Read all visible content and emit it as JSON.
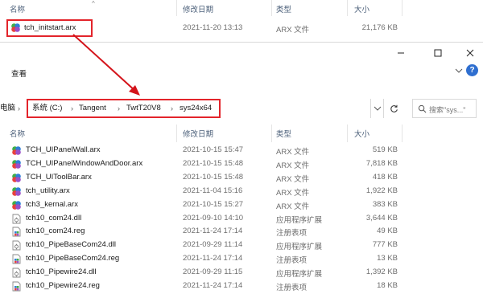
{
  "back_window": {
    "columns": {
      "name": "名称",
      "date": "修改日期",
      "type": "类型",
      "size": "大小"
    },
    "file": {
      "name": "tch_initstart.arx",
      "date": "2021-11-20 13:13",
      "type": "ARX 文件",
      "size": "21,176 KB"
    }
  },
  "front_window": {
    "toolbar": {
      "view_label": "查看"
    },
    "address": {
      "root": "电脑",
      "crumbs": [
        "系统 (C:)",
        "Tangent",
        "TwtT20V8",
        "sys24x64"
      ]
    },
    "search": {
      "placeholder": "搜索\"sys...\""
    },
    "columns": {
      "name": "名称",
      "date": "修改日期",
      "type": "类型",
      "size": "大小"
    },
    "files": [
      {
        "name": "TCH_UIPanelWall.arx",
        "date": "2021-10-15 15:47",
        "type": "ARX 文件",
        "size": "519 KB",
        "icon": "arx-icon"
      },
      {
        "name": "TCH_UIPanelWindowAndDoor.arx",
        "date": "2021-10-15 15:48",
        "type": "ARX 文件",
        "size": "7,818 KB",
        "icon": "arx-icon"
      },
      {
        "name": "TCH_UIToolBar.arx",
        "date": "2021-10-15 15:48",
        "type": "ARX 文件",
        "size": "418 KB",
        "icon": "arx-icon"
      },
      {
        "name": "tch_utility.arx",
        "date": "2021-11-04 15:16",
        "type": "ARX 文件",
        "size": "1,922 KB",
        "icon": "arx-icon"
      },
      {
        "name": "tch3_kernal.arx",
        "date": "2021-10-15 15:27",
        "type": "ARX 文件",
        "size": "383 KB",
        "icon": "arx-icon"
      },
      {
        "name": "tch10_com24.dll",
        "date": "2021-09-10 14:10",
        "type": "应用程序扩展",
        "size": "3,644 KB",
        "icon": "dll-icon"
      },
      {
        "name": "tch10_com24.reg",
        "date": "2021-11-24 17:14",
        "type": "注册表项",
        "size": "49 KB",
        "icon": "reg-icon"
      },
      {
        "name": "tch10_PipeBaseCom24.dll",
        "date": "2021-09-29 11:14",
        "type": "应用程序扩展",
        "size": "777 KB",
        "icon": "dll-icon"
      },
      {
        "name": "tch10_PipeBaseCom24.reg",
        "date": "2021-11-24 17:14",
        "type": "注册表项",
        "size": "13 KB",
        "icon": "reg-icon"
      },
      {
        "name": "tch10_Pipewire24.dll",
        "date": "2021-09-29 11:15",
        "type": "应用程序扩展",
        "size": "1,392 KB",
        "icon": "dll-icon"
      },
      {
        "name": "tch10_Pipewire24.reg",
        "date": "2021-11-24 17:14",
        "type": "注册表项",
        "size": "18 KB",
        "icon": "reg-icon"
      }
    ]
  },
  "colors": {
    "highlight": "#e3242b",
    "header_text": "#4c607a",
    "arrow": "#d4141b"
  }
}
